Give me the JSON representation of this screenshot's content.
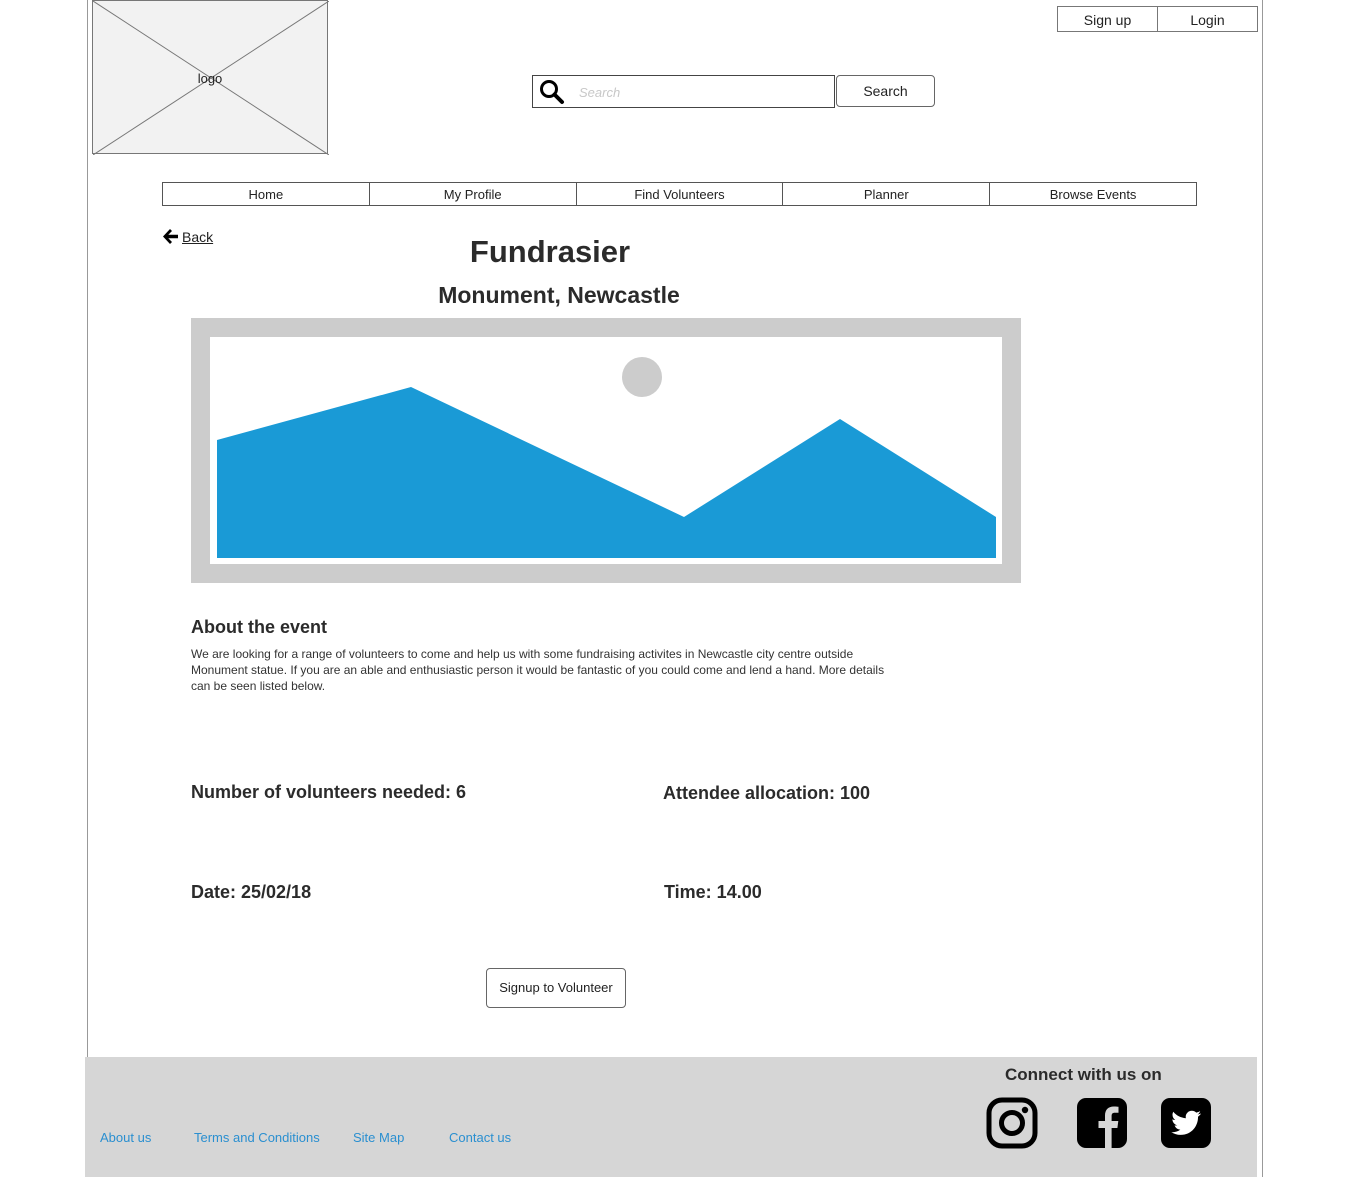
{
  "header": {
    "logo_label": "logo",
    "auth": {
      "signup_label": "Sign up",
      "login_label": "Login"
    },
    "search": {
      "placeholder": "Search",
      "button_label": "Search"
    }
  },
  "nav": {
    "items": [
      {
        "label": "Home"
      },
      {
        "label": "My Profile"
      },
      {
        "label": "Find Volunteers"
      },
      {
        "label": "Planner"
      },
      {
        "label": "Browse Events"
      }
    ]
  },
  "page": {
    "back_label": "Back",
    "title": "Fundrasier",
    "location": "Monument, Newcastle",
    "about_heading": "About the event",
    "about_text": "We are looking for a range of volunteers to come and help us with some fundraising activites in Newcastle city centre outside Monument statue. If you are an able and enthusiastic person it would be fantastic of you could come and lend a hand. More details can be seen listed below.",
    "details": {
      "volunteers": "Number of volunteers needed: 6",
      "attendees": "Attendee allocation: 100",
      "date": "Date: 25/02/18",
      "time": "Time: 14.00"
    },
    "signup_button": "Signup to Volunteer"
  },
  "footer": {
    "links": [
      {
        "label": "About us"
      },
      {
        "label": "Terms and Conditions"
      },
      {
        "label": "Site Map"
      },
      {
        "label": "Contact us"
      }
    ],
    "connect_label": "Connect with us on",
    "social": [
      "instagram-icon",
      "facebook-icon",
      "twitter-icon"
    ]
  },
  "colors": {
    "accent_blue": "#1a9ad6",
    "footer_bg": "#d6d6d6",
    "link_color": "#2a8fd0",
    "image_frame": "#cccccc"
  }
}
